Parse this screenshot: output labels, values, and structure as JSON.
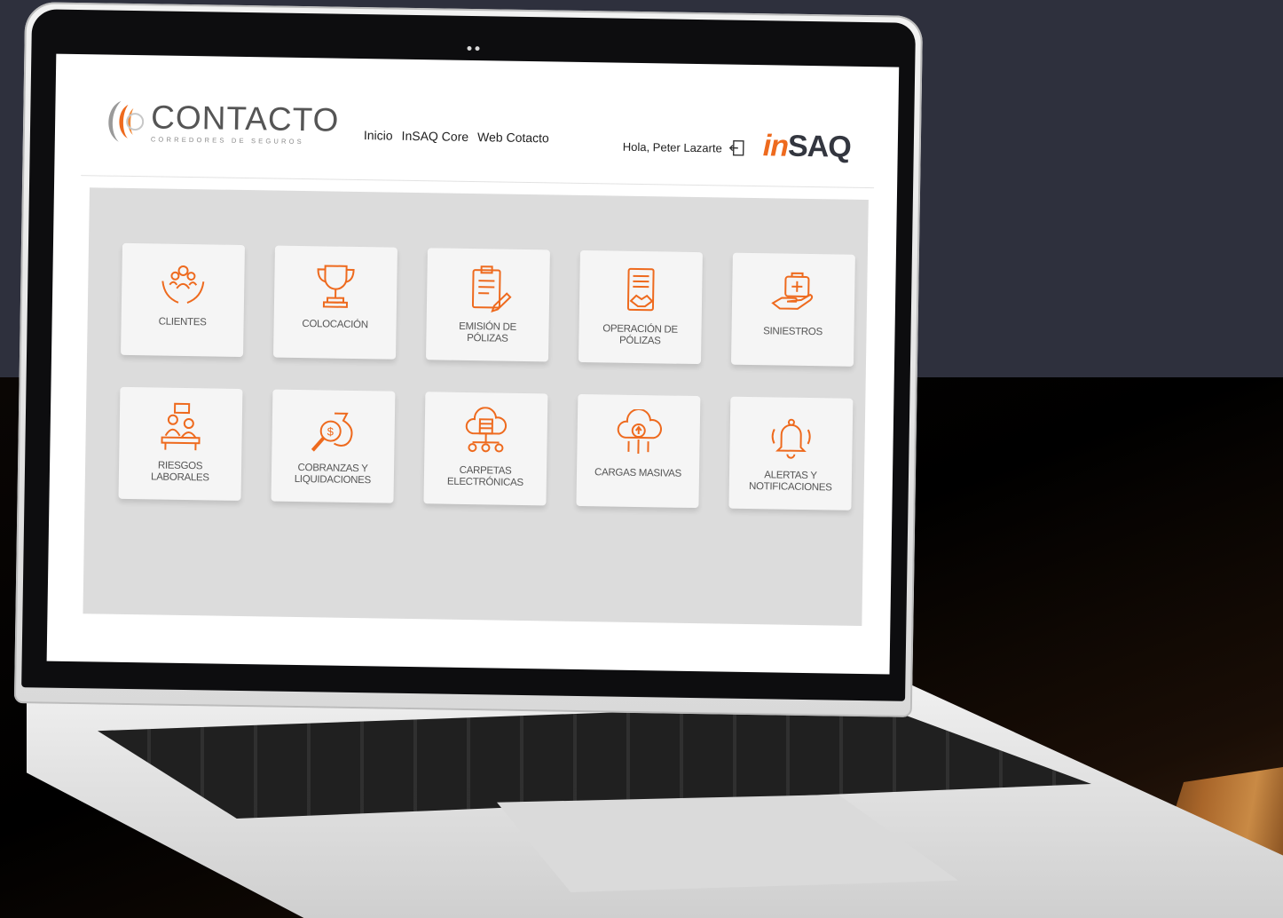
{
  "header": {
    "logo_name": "CONTACTO",
    "logo_subtitle": "CORREDORES DE SEGUROS",
    "nav": [
      "Inicio",
      "InSAQ Core",
      "Web Cotacto"
    ],
    "greeting": "Hola, Peter Lazarte",
    "brand_prefix": "in",
    "brand_suffix": "SAQ"
  },
  "modules": [
    {
      "label": "CLIENTES",
      "icon": "hands-people-icon"
    },
    {
      "label": "COLOCACIÓN",
      "icon": "trophy-icon"
    },
    {
      "label": "EMISIÓN DE PÓLIZAS",
      "icon": "clipboard-pen-icon"
    },
    {
      "label": "OPERACIÓN DE PÓLIZAS",
      "icon": "document-handshake-icon"
    },
    {
      "label": "SINIESTROS",
      "icon": "hand-medical-kit-icon"
    },
    {
      "label": "RIESGOS LABORALES",
      "icon": "worker-desk-icon"
    },
    {
      "label": "COBRANZAS Y LIQUIDACIONES",
      "icon": "money-bag-search-icon"
    },
    {
      "label": "CARPETAS ELECTRÓNICAS",
      "icon": "cloud-database-icon"
    },
    {
      "label": "CARGAS MASIVAS",
      "icon": "cloud-upload-icon"
    },
    {
      "label": "ALERTAS Y NOTIFICACIONES",
      "icon": "bell-alert-icon"
    }
  ],
  "colors": {
    "accent": "#ee6a1e",
    "dashboard_bg": "#dcdcdc",
    "card_bg": "#f5f5f5",
    "page_bg_top": "#2e303d"
  }
}
